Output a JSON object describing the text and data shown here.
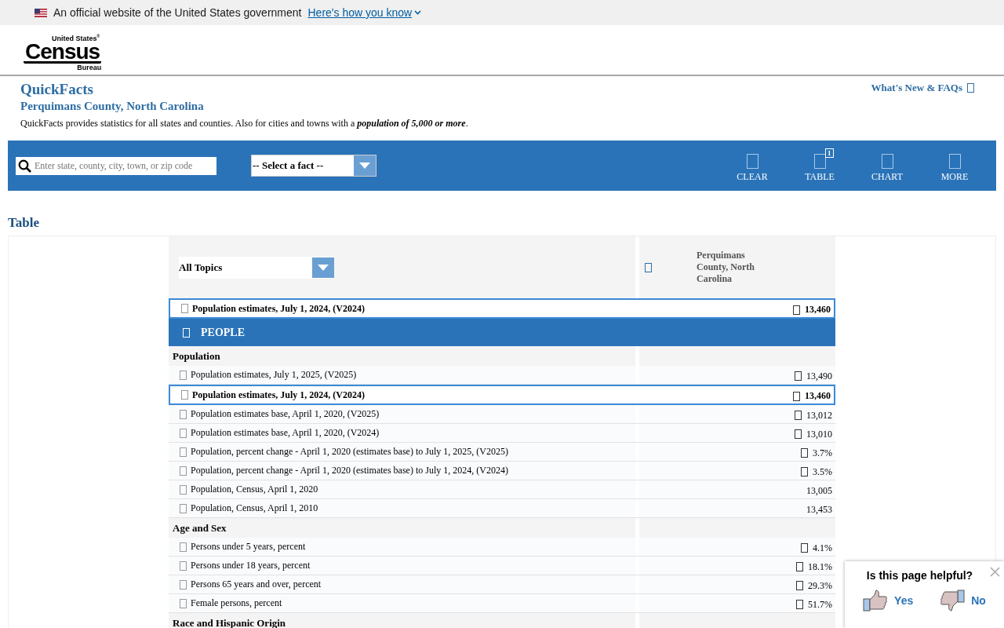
{
  "banner": {
    "text": "An official website of the United States government",
    "link": "Here's how you know"
  },
  "logo": {
    "top": "United States$^{®}$",
    "main": "Census",
    "bottom": "Bureau"
  },
  "intro": {
    "title": "QuickFacts",
    "subtitle": "Perquimans County, North Carolina",
    "whats_new": "What's New & FAQs",
    "description": "QuickFacts provides statistics for all states and counties. Also for cities and towns with a **population of 5,000 or more**."
  },
  "toolbar": {
    "search_placeholder": "Enter state, county, city, town, or zip code",
    "fact_select": "-- Select a fact --",
    "buttons": [
      {
        "label": "CLEAR"
      },
      {
        "label": "TABLE",
        "badge": "1"
      },
      {
        "label": "CHART"
      },
      {
        "label": "MORE"
      }
    ]
  },
  "table": {
    "heading": "Table",
    "topic_select": "All Topics",
    "column": "Perquimans County, North Carolina",
    "pinned": {
      "label": "Population estimates, July 1, 2024, (V2024)",
      "value": "13,460"
    },
    "section": "PEOPLE",
    "groups": [
      {
        "title": "Population",
        "rows": [
          {
            "label": "Population estimates, July 1, 2025, (V2025)",
            "value": "13,490",
            "note_icon": true,
            "selected": false
          },
          {
            "label": "Population estimates, July 1, 2024, (V2024)",
            "value": "13,460",
            "note_icon": true,
            "selected": true
          },
          {
            "label": "Population estimates base, April 1, 2020, (V2025)",
            "value": "13,012",
            "note_icon": true,
            "selected": false
          },
          {
            "label": "Population estimates base, April 1, 2020, (V2024)",
            "value": "13,010",
            "note_icon": true,
            "selected": false
          },
          {
            "label": "Population, percent change - April 1, 2020 (estimates base) to July 1, 2025, (V2025)",
            "value": "3.7%",
            "note_icon": true,
            "selected": false
          },
          {
            "label": "Population, percent change - April 1, 2020 (estimates base) to July 1, 2024, (V2024)",
            "value": "3.5%",
            "note_icon": true,
            "selected": false
          },
          {
            "label": "Population, Census, April 1, 2020",
            "value": "13,005",
            "note_icon": false,
            "selected": false
          },
          {
            "label": "Population, Census, April 1, 2010",
            "value": "13,453",
            "note_icon": false,
            "selected": false
          }
        ]
      },
      {
        "title": "Age and Sex",
        "rows": [
          {
            "label": "Persons under 5 years, percent",
            "value": "4.1%",
            "note_icon": true,
            "selected": false
          },
          {
            "label": "Persons under 18 years, percent",
            "value": "18.1%",
            "note_icon": true,
            "selected": false
          },
          {
            "label": "Persons 65 years and over, percent",
            "value": "29.3%",
            "note_icon": true,
            "selected": false
          },
          {
            "label": "Female persons, percent",
            "value": "51.7%",
            "note_icon": true,
            "selected": false
          }
        ]
      },
      {
        "title": "Race and Hispanic Origin"
      }
    ]
  },
  "feedback": {
    "question": "Is this page helpful?",
    "yes": "Yes",
    "no": "No"
  }
}
